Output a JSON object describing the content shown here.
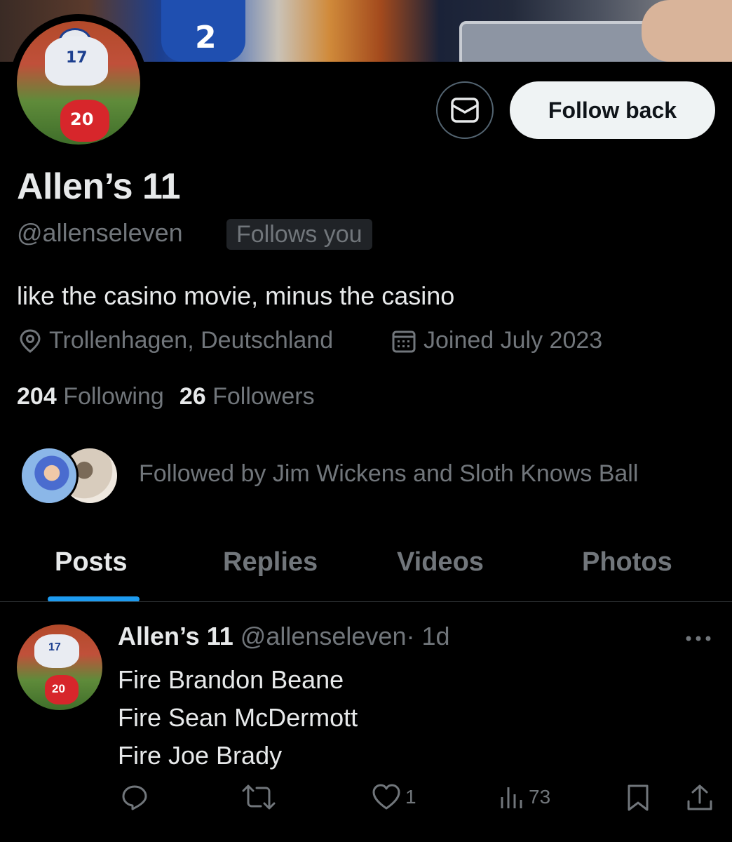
{
  "profile": {
    "name": "Allen’s 11",
    "handle": "@allenseleven",
    "follows_you_badge": "Follows you",
    "bio": "like the casino movie, minus the casino",
    "location": "Trollenhagen, Deutschland",
    "joined": "Joined July 2023",
    "following_count": "204",
    "following_label": "Following",
    "followers_count": "26",
    "followers_label": "Followers",
    "followed_by_text": "Followed by Jim Wickens and Sloth Knows Ball",
    "avatar_jersey_top": "17",
    "avatar_jersey_bottom": "20",
    "banner_jersey_number": "2"
  },
  "actions": {
    "message_icon": "envelope-icon",
    "follow_back_label": "Follow back"
  },
  "tabs": [
    {
      "label": "Posts",
      "active": true
    },
    {
      "label": "Replies",
      "active": false
    },
    {
      "label": "Videos",
      "active": false
    },
    {
      "label": "Photos",
      "active": false
    }
  ],
  "post": {
    "author_name": "Allen’s 11",
    "author_handle": "@allenseleven",
    "time": "· 1d",
    "more_icon": "ellipsis-icon",
    "lines": [
      "Fire Brandon Beane",
      "Fire Sean McDermott",
      "Fire Joe Brady"
    ],
    "likes": "1",
    "views": "73"
  },
  "colors": {
    "background": "#000000",
    "primary_text": "#e7e9ea",
    "secondary_text": "#71767b",
    "accent_blue": "#1d9bf0",
    "button_bg": "#eff3f4"
  }
}
